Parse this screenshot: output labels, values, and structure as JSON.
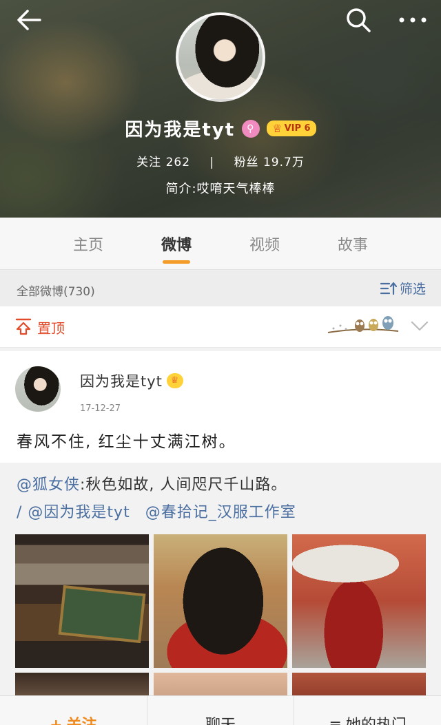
{
  "header": {
    "profile_name": "因为我是tyt",
    "vip_label": "VIP 6",
    "following_label": "关注",
    "following_count": "262",
    "separator": "|",
    "followers_label": "粉丝",
    "followers_count": "19.7万",
    "bio": "简介:哎唷天气棒棒"
  },
  "tabs": [
    {
      "label": "主页"
    },
    {
      "label": "微博",
      "active": true
    },
    {
      "label": "视频"
    },
    {
      "label": "故事"
    }
  ],
  "feed_bar": {
    "all_label": "全部微博(730)",
    "filter_label": "筛选"
  },
  "pinned": {
    "label": "置顶"
  },
  "post": {
    "author": "因为我是tyt",
    "date": "17-12-27",
    "text": "春风不住, 红尘十丈满江树。",
    "repost_author": "@狐女侠",
    "repost_text": ":秋色如故, 人间咫尺千山路。",
    "repost_line2_prefix": "/",
    "mention_1": "@因为我是tyt",
    "mention_2": "@春拾记_汉服工作室"
  },
  "bottom_bar": {
    "follow_icon": "+",
    "follow_label": "关注",
    "chat_label": "聊天",
    "hot_icon": "≡",
    "hot_label": "她的热门"
  },
  "icons": [
    "back-arrow-icon",
    "search-icon",
    "more-icon",
    "verified-icon",
    "crown-icon",
    "filter-icon",
    "pin-icon",
    "owls-decoration-icon",
    "chevron-down-icon"
  ],
  "colors": {
    "accent_orange": "#f39c29",
    "pin_red": "#e24b2a",
    "link_blue": "#4a6ea0",
    "vip_yellow": "#ffd23a",
    "verify_pink": "#f08bc0"
  }
}
